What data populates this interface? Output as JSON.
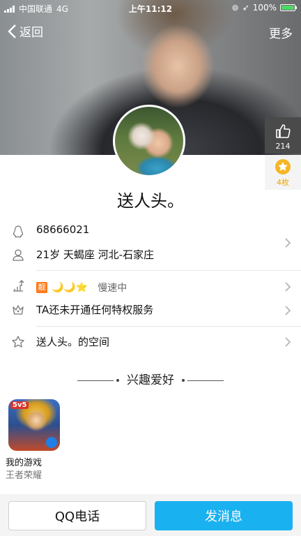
{
  "status_bar": {
    "carrier": "中国联通",
    "network": "4G",
    "time": "上午11:12",
    "battery": "100%"
  },
  "nav": {
    "back_label": "返回",
    "more_label": "更多"
  },
  "side": {
    "like_count": "214",
    "badge_count": "4枚"
  },
  "profile": {
    "nickname": "送人头。"
  },
  "info_rows": {
    "qq_number": "68666021",
    "basic_info": "21岁 天蝎座 河北-石家庄",
    "vip_badge": "靓",
    "level_icons": "🌙🌙⭐",
    "speed_status": "慢速中",
    "privilege": "TA还未开通任何特权服务",
    "space": "送人头。的空间"
  },
  "interests": {
    "section_title": "兴趣爱好",
    "game_header": "我的游戏",
    "game_tag": "5v5",
    "game_name": "王者荣耀"
  },
  "bottom_bar": {
    "call_label": "QQ电话",
    "message_label": "发消息"
  },
  "colors": {
    "primary": "#1ab1f0",
    "badge_orange": "#ff7a1a",
    "star_gold": "#f5b623"
  }
}
